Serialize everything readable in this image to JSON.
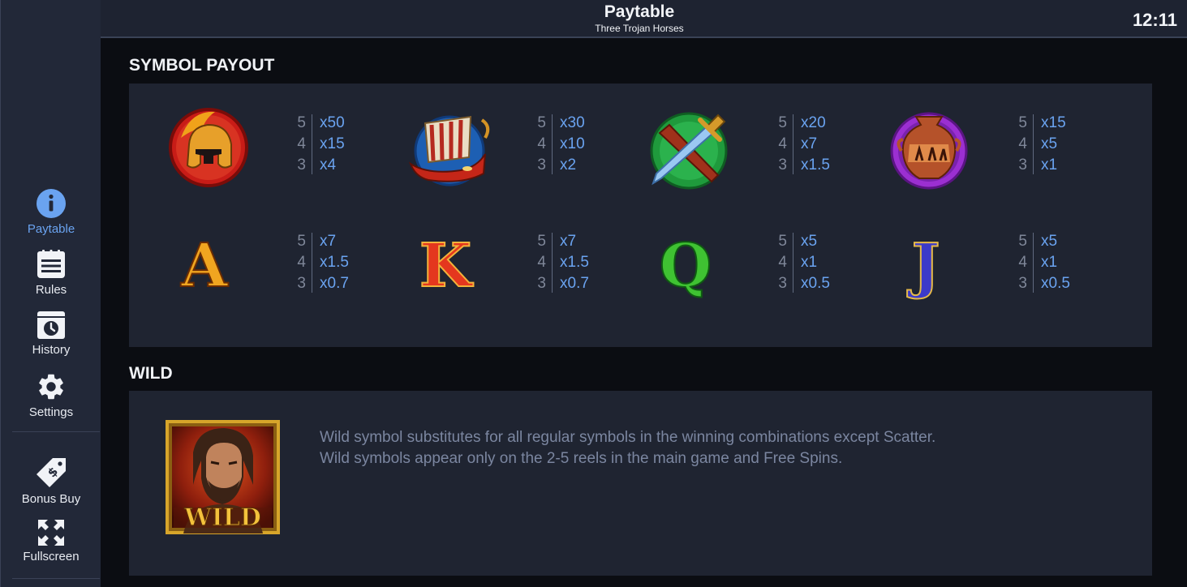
{
  "header": {
    "title": "Paytable",
    "subtitle": "Three Trojan Horses",
    "clock": "12:11"
  },
  "sidebar": {
    "items": [
      {
        "label": "Paytable",
        "icon": "info-icon",
        "active": true
      },
      {
        "label": "Rules",
        "icon": "rules-list-icon"
      },
      {
        "label": "History",
        "icon": "history-clock-icon"
      },
      {
        "label": "Settings",
        "icon": "gear-icon"
      },
      {
        "label": "Bonus Buy",
        "icon": "price-tag-icon"
      },
      {
        "label": "Fullscreen",
        "icon": "fullscreen-arrows-icon"
      }
    ],
    "accent_color": "#6aa3f0"
  },
  "symbol_payout": {
    "title": "SYMBOL PAYOUT",
    "symbols": [
      {
        "name": "helmet",
        "icon": "spartan-helmet-icon",
        "counts": [
          "5",
          "4",
          "3"
        ],
        "multipliers": [
          "x50",
          "x15",
          "x4"
        ]
      },
      {
        "name": "ship",
        "icon": "trireme-ship-icon",
        "counts": [
          "5",
          "4",
          "3"
        ],
        "multipliers": [
          "x30",
          "x10",
          "x2"
        ]
      },
      {
        "name": "sword",
        "icon": "sword-sheath-icon",
        "counts": [
          "5",
          "4",
          "3"
        ],
        "multipliers": [
          "x20",
          "x7",
          "x1.5"
        ]
      },
      {
        "name": "vase",
        "icon": "greek-vase-icon",
        "counts": [
          "5",
          "4",
          "3"
        ],
        "multipliers": [
          "x15",
          "x5",
          "x1"
        ]
      },
      {
        "name": "A",
        "letter": "A",
        "counts": [
          "5",
          "4",
          "3"
        ],
        "multipliers": [
          "x7",
          "x1.5",
          "x0.7"
        ]
      },
      {
        "name": "K",
        "letter": "K",
        "counts": [
          "5",
          "4",
          "3"
        ],
        "multipliers": [
          "x7",
          "x1.5",
          "x0.7"
        ]
      },
      {
        "name": "Q",
        "letter": "Q",
        "counts": [
          "5",
          "4",
          "3"
        ],
        "multipliers": [
          "x5",
          "x1",
          "x0.5"
        ]
      },
      {
        "name": "J",
        "letter": "J",
        "counts": [
          "5",
          "4",
          "3"
        ],
        "multipliers": [
          "x5",
          "x1",
          "x0.5"
        ]
      }
    ]
  },
  "wild": {
    "title": "WILD",
    "symbol_label": "WILD",
    "icon": "wild-hero-portrait-icon",
    "description": [
      "Wild symbol substitutes for all regular symbols in the winning combinations except Scatter.",
      "Wild symbols appear only on the 2-5 reels in the main game and Free Spins."
    ]
  }
}
